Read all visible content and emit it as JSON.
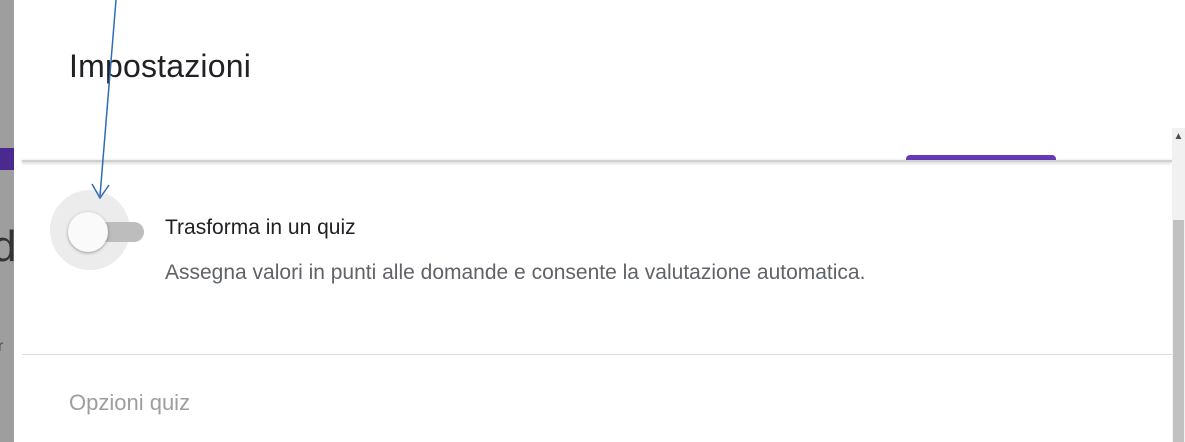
{
  "background": {
    "partial_letter": "d",
    "partial_small_letter": "r"
  },
  "dialog": {
    "title": "Impostazioni"
  },
  "quiz_setting": {
    "title": "Trasforma in un quiz",
    "description": "Assegna valori in punti alle domande e consente la valutazione automatica.",
    "toggle_state": "off"
  },
  "sections": {
    "quiz_options_header": "Opzioni quiz"
  },
  "scrollbar": {
    "up_arrow_icon": "▲"
  },
  "colors": {
    "accent": "#673ab7",
    "annotation_arrow": "#2f6db5",
    "text_primary": "#202124",
    "text_secondary": "#5f6368",
    "text_disabled": "#9e9e9e"
  }
}
